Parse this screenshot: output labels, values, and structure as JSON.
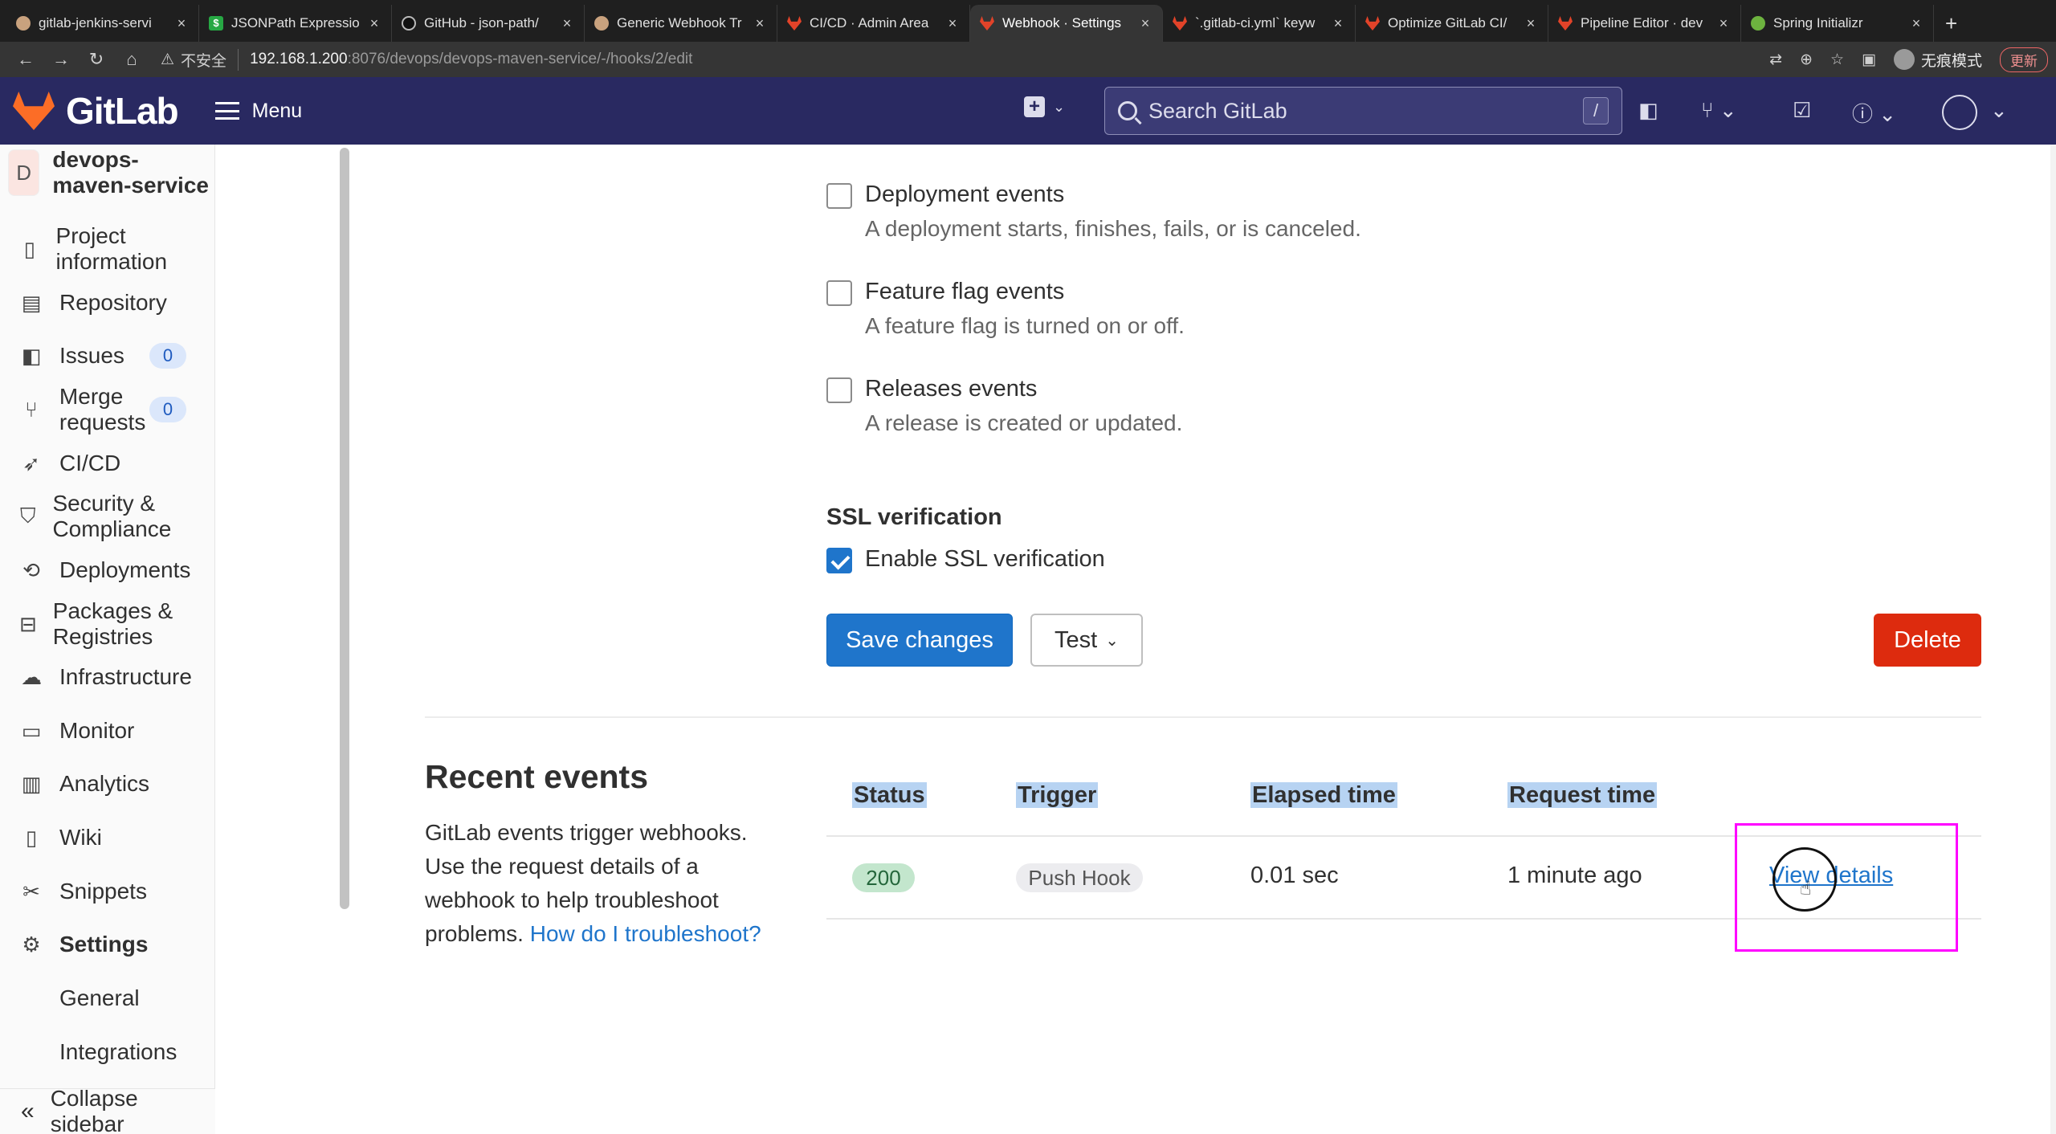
{
  "browser": {
    "tabs": [
      {
        "title": "gitlab-jenkins-servi",
        "active": false
      },
      {
        "title": "JSONPath Expressio",
        "active": false
      },
      {
        "title": "GitHub - json-path/",
        "active": false
      },
      {
        "title": "Generic Webhook Tr",
        "active": false
      },
      {
        "title": "CI/CD · Admin Area",
        "active": false
      },
      {
        "title": "Webhook · Settings",
        "active": true
      },
      {
        "title": "`.gitlab-ci.yml` keyw",
        "active": false
      },
      {
        "title": "Optimize GitLab CI/",
        "active": false
      },
      {
        "title": "Pipeline Editor · dev",
        "active": false
      },
      {
        "title": "Spring Initializr",
        "active": false
      }
    ],
    "address": {
      "security_label": "不安全",
      "host": "192.168.1.200",
      "path": ":8076/devops/devops-maven-service/-/hooks/2/edit"
    },
    "incognito_label": "无痕模式",
    "update_label": "更新"
  },
  "header": {
    "brand": "GitLab",
    "menu_label": "Menu",
    "search_placeholder": "Search GitLab",
    "search_shortcut": "/"
  },
  "sidebar": {
    "project_initial": "D",
    "project_name": "devops-maven-service",
    "items": [
      {
        "label": "Project information",
        "icon": "project-icon"
      },
      {
        "label": "Repository",
        "icon": "file-icon"
      },
      {
        "label": "Issues",
        "icon": "issues-icon",
        "badge": "0"
      },
      {
        "label": "Merge requests",
        "icon": "merge-request-icon",
        "badge": "0"
      },
      {
        "label": "CI/CD",
        "icon": "rocket-icon"
      },
      {
        "label": "Security & Compliance",
        "icon": "shield-icon"
      },
      {
        "label": "Deployments",
        "icon": "deployments-icon"
      },
      {
        "label": "Packages & Registries",
        "icon": "package-icon"
      },
      {
        "label": "Infrastructure",
        "icon": "cloud-gear-icon"
      },
      {
        "label": "Monitor",
        "icon": "monitor-icon"
      },
      {
        "label": "Analytics",
        "icon": "chart-icon"
      },
      {
        "label": "Wiki",
        "icon": "book-icon"
      },
      {
        "label": "Snippets",
        "icon": "scissors-icon"
      },
      {
        "label": "Settings",
        "icon": "settings-icon"
      }
    ],
    "sub_items": [
      "General",
      "Integrations"
    ],
    "collapse_label": "Collapse sidebar"
  },
  "form": {
    "triggers": [
      {
        "label": "Deployment events",
        "help": "A deployment starts, finishes, fails, or is canceled.",
        "checked": false
      },
      {
        "label": "Feature flag events",
        "help": "A feature flag is turned on or off.",
        "checked": false
      },
      {
        "label": "Releases events",
        "help": "A release is created or updated.",
        "checked": false
      }
    ],
    "ssl_title": "SSL verification",
    "ssl_label": "Enable SSL verification",
    "ssl_checked": true,
    "save_label": "Save changes",
    "test_label": "Test",
    "delete_label": "Delete"
  },
  "recent_events": {
    "title": "Recent events",
    "description": "GitLab events trigger webhooks. Use the request details of a webhook to help troubleshoot problems.",
    "help_link": "How do I troubleshoot?",
    "columns": [
      "Status",
      "Trigger",
      "Elapsed time",
      "Request time"
    ],
    "rows": [
      {
        "status": "200",
        "trigger": "Push Hook",
        "elapsed": "0.01 sec",
        "request_time": "1 minute ago",
        "action": "View details"
      }
    ]
  },
  "colors": {
    "header_bg": "#292961",
    "primary": "#1f75cb",
    "danger": "#dd2b0e",
    "annotation": "#ff00ff"
  }
}
